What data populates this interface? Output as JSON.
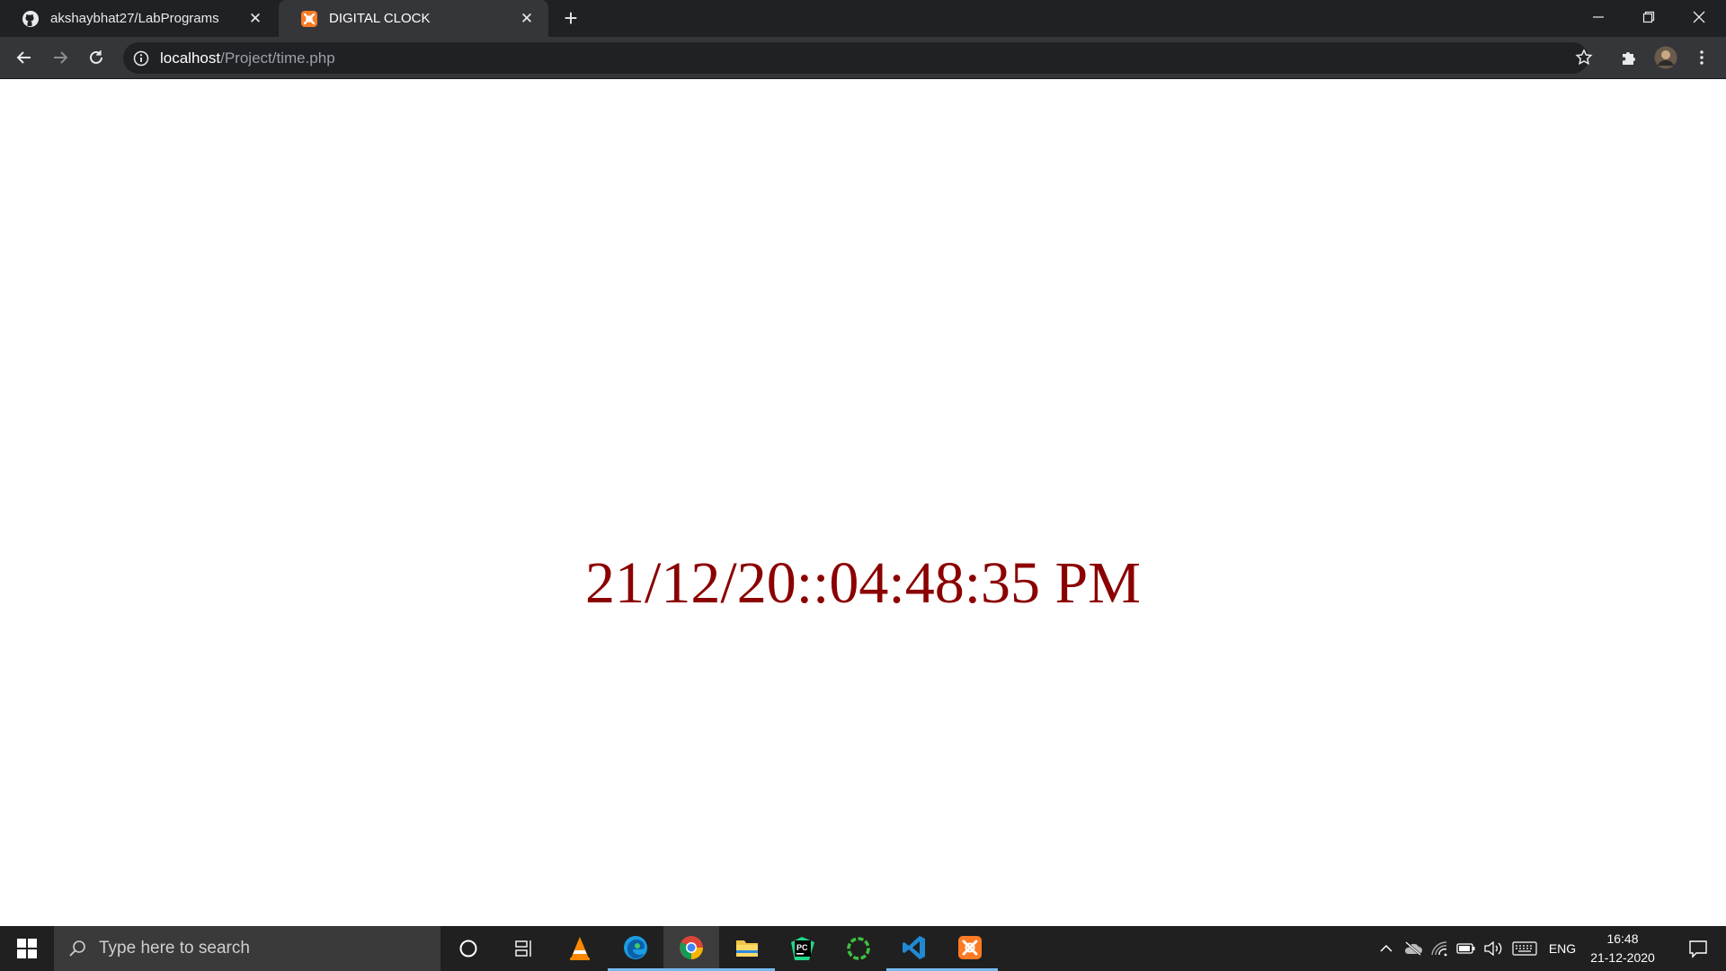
{
  "browser": {
    "tabs": [
      {
        "title": "akshaybhat27/LabPrograms",
        "icon": "github-icon"
      },
      {
        "title": "DIGITAL CLOCK",
        "icon": "xampp-icon"
      }
    ],
    "address": {
      "host": "localhost",
      "path": "/Project/time.php"
    }
  },
  "page": {
    "clock_text": "21/12/20::04:48:35 PM",
    "clock_color": "#8b0000"
  },
  "taskbar": {
    "search_placeholder": "Type here to search",
    "apps": [
      "cortana-icon",
      "task-view-icon",
      "vlc-icon",
      "edge-icon",
      "chrome-icon",
      "file-explorer-icon",
      "pycharm-icon",
      "refresh-app-icon",
      "vscode-icon",
      "xampp-icon"
    ],
    "tray": {
      "language": "ENG",
      "time": "16:48",
      "date": "21-12-2020"
    }
  }
}
